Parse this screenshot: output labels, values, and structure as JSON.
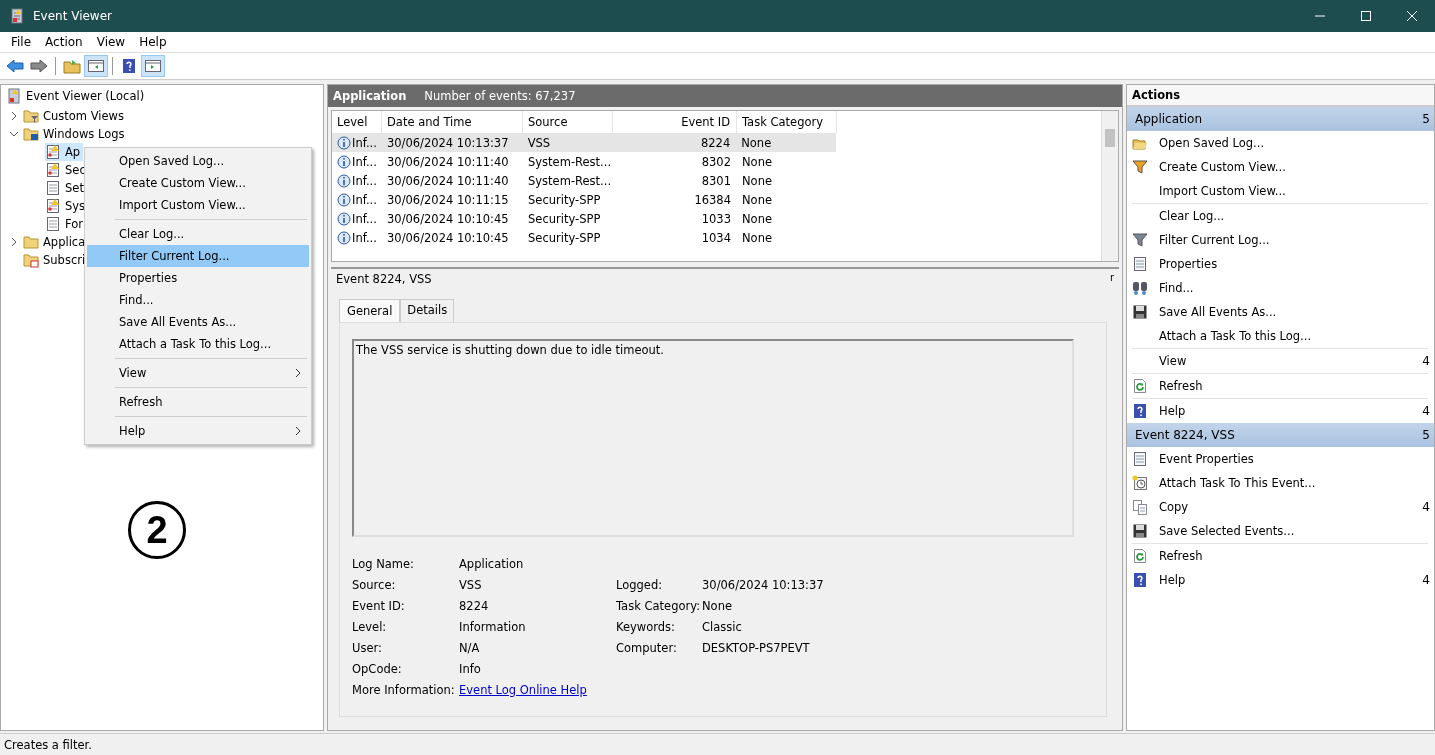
{
  "window": {
    "title": "Event Viewer"
  },
  "menu": [
    "File",
    "Action",
    "View",
    "Help"
  ],
  "tree": [
    {
      "label": "Event Viewer (Local)",
      "kind": "viewer",
      "selected": false,
      "children": [
        {
          "label": "Custom Views",
          "kind": "filter-folder",
          "expanded": false,
          "selected": false
        },
        {
          "label": "Windows Logs",
          "kind": "pc-folder",
          "expanded": true,
          "selected": false,
          "children": [
            {
              "label": "Ap",
              "kind": "warn-log",
              "selected": true
            },
            {
              "label": "Sec",
              "kind": "warn-log",
              "selected": false
            },
            {
              "label": "Set",
              "kind": "log",
              "selected": false
            },
            {
              "label": "Sys",
              "kind": "warn-log",
              "selected": false
            },
            {
              "label": "For",
              "kind": "log",
              "selected": false
            }
          ]
        },
        {
          "label": "Applica",
          "kind": "folder",
          "expanded": false,
          "selected": false
        },
        {
          "label": "Subscri",
          "kind": "sub-folder",
          "selected": false
        }
      ]
    }
  ],
  "context_menu": [
    {
      "label": "Open Saved Log...",
      "selected": false,
      "submenu": false,
      "separator_after": false
    },
    {
      "label": "Create Custom View...",
      "selected": false,
      "submenu": false,
      "separator_after": false
    },
    {
      "label": "Import Custom View...",
      "selected": false,
      "submenu": false,
      "separator_after": true
    },
    {
      "label": "Clear Log...",
      "selected": false,
      "submenu": false,
      "separator_after": false
    },
    {
      "label": "Filter Current Log...",
      "selected": true,
      "submenu": false,
      "separator_after": false
    },
    {
      "label": "Properties",
      "selected": false,
      "submenu": false,
      "separator_after": false
    },
    {
      "label": "Find...",
      "selected": false,
      "submenu": false,
      "separator_after": false
    },
    {
      "label": "Save All Events As...",
      "selected": false,
      "submenu": false,
      "separator_after": false
    },
    {
      "label": "Attach a Task To this Log...",
      "selected": false,
      "submenu": false,
      "separator_after": true
    },
    {
      "label": "View",
      "selected": false,
      "submenu": true,
      "separator_after": true
    },
    {
      "label": "Refresh",
      "selected": false,
      "submenu": false,
      "separator_after": true
    },
    {
      "label": "Help",
      "selected": false,
      "submenu": true,
      "separator_after": false
    }
  ],
  "annotation": "2",
  "log_header": {
    "title": "Application",
    "count": "Number of events: 67,237"
  },
  "table": {
    "columns": [
      "Level",
      "Date and Time",
      "Source",
      "Event ID",
      "Task Category"
    ],
    "rows": [
      {
        "level": "Inf...",
        "date": "30/06/2024 10:13:37",
        "source": "VSS",
        "event_id": "8224",
        "task": "None",
        "selected": true
      },
      {
        "level": "Inf...",
        "date": "30/06/2024 10:11:40",
        "source": "System-Rest...",
        "event_id": "8302",
        "task": "None",
        "selected": false
      },
      {
        "level": "Inf...",
        "date": "30/06/2024 10:11:40",
        "source": "System-Rest...",
        "event_id": "8301",
        "task": "None",
        "selected": false
      },
      {
        "level": "Inf...",
        "date": "30/06/2024 10:11:15",
        "source": "Security-SPP",
        "event_id": "16384",
        "task": "None",
        "selected": false
      },
      {
        "level": "Inf...",
        "date": "30/06/2024 10:10:45",
        "source": "Security-SPP",
        "event_id": "1033",
        "task": "None",
        "selected": false
      },
      {
        "level": "Inf...",
        "date": "30/06/2024 10:10:45",
        "source": "Security-SPP",
        "event_id": "1034",
        "task": "None",
        "selected": false
      }
    ]
  },
  "event": {
    "title": "Event 8224, VSS",
    "close_glyph": "r",
    "tabs": [
      {
        "label": "General",
        "selected": true
      },
      {
        "label": "Details",
        "selected": false
      }
    ],
    "description": "The VSS service is shutting down due to idle timeout.",
    "fields_left": [
      {
        "label": "Log Name:",
        "value": "Application"
      },
      {
        "label": "Source:",
        "value": "VSS"
      },
      {
        "label": "Event ID:",
        "value": "8224"
      },
      {
        "label": "Level:",
        "value": "Information"
      },
      {
        "label": "User:",
        "value": "N/A"
      },
      {
        "label": "OpCode:",
        "value": "Info"
      }
    ],
    "fields_right": [
      {
        "label": "Logged:",
        "value": "30/06/2024 10:13:37"
      },
      {
        "label": "Task Category:",
        "value": "None"
      },
      {
        "label": "Keywords:",
        "value": "Classic"
      },
      {
        "label": "Computer:",
        "value": "DESKTOP-PS7PEVT"
      }
    ],
    "more_info": {
      "label": "More Information:",
      "link": "Event Log Online Help"
    }
  },
  "actions": {
    "title": "Actions",
    "sections": [
      {
        "title": "Application",
        "arrow": "5",
        "items": [
          {
            "label": "Open Saved Log...",
            "kind": "open",
            "separator_after": false
          },
          {
            "label": "Create Custom View...",
            "kind": "funnel-star",
            "separator_after": false
          },
          {
            "label": "Import Custom View...",
            "kind": "plain",
            "separator_after": true
          },
          {
            "label": "Clear Log...",
            "kind": "plain",
            "separator_after": false
          },
          {
            "label": "Filter Current Log...",
            "kind": "funnel",
            "separator_after": false
          },
          {
            "label": "Properties",
            "kind": "props",
            "separator_after": false
          },
          {
            "label": "Find...",
            "kind": "binoculars",
            "separator_after": false
          },
          {
            "label": "Save All Events As...",
            "kind": "disk",
            "separator_after": false
          },
          {
            "label": "Attach a Task To this Log...",
            "kind": "plain",
            "separator_after": true
          },
          {
            "label": "View",
            "kind": "plain",
            "arrow": "4",
            "separator_after": true
          },
          {
            "label": "Refresh",
            "kind": "refresh",
            "separator_after": true
          },
          {
            "label": "Help",
            "kind": "help",
            "arrow": "4",
            "separator_after": false
          }
        ]
      },
      {
        "title": "Event 8224, VSS",
        "arrow": "5",
        "items": [
          {
            "label": "Event Properties",
            "kind": "props",
            "separator_after": false
          },
          {
            "label": "Attach Task To This Event...",
            "kind": "clock",
            "separator_after": false
          },
          {
            "label": "Copy",
            "kind": "copy",
            "arrow": "4",
            "separator_after": false
          },
          {
            "label": "Save Selected Events...",
            "kind": "disk",
            "separator_after": true
          },
          {
            "label": "Refresh",
            "kind": "refresh",
            "separator_after": false
          },
          {
            "label": "Help",
            "kind": "help",
            "arrow": "4",
            "separator_after": false
          }
        ]
      }
    ]
  },
  "status_bar": "Creates a filter."
}
